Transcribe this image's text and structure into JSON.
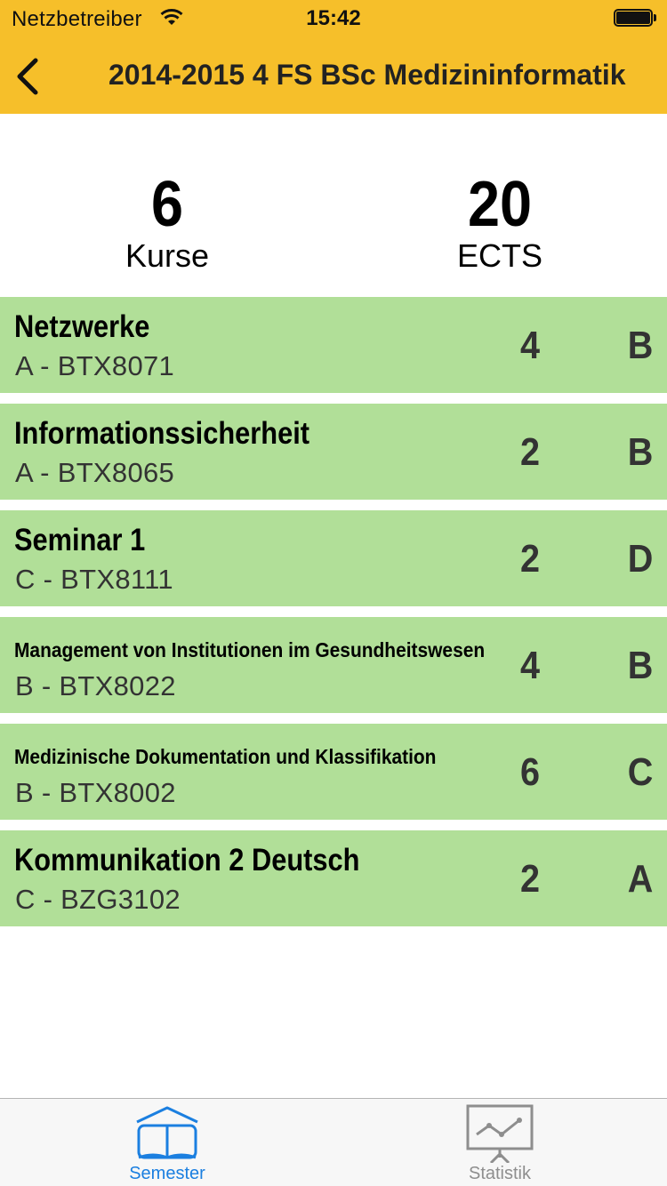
{
  "status_bar": {
    "carrier": "Netzbetreiber",
    "time": "15:42"
  },
  "nav": {
    "title": "2014-2015 4 FS BSc Medizininformatik",
    "back_icon": "chevron-left-icon"
  },
  "summary": {
    "courses_count": "6",
    "courses_label": "Kurse",
    "ects_total": "20",
    "ects_label": "ECTS"
  },
  "courses": [
    {
      "name": "Netzwerke",
      "code": "A - BTX8071",
      "ects": "4",
      "grade": "B"
    },
    {
      "name": "Informationssicherheit",
      "code": "A - BTX8065",
      "ects": "2",
      "grade": "B"
    },
    {
      "name": "Seminar 1",
      "code": "C - BTX8111",
      "ects": "2",
      "grade": "D"
    },
    {
      "name": "Management von Institutionen im Gesundheitswesen",
      "code": "B - BTX8022",
      "ects": "4",
      "grade": "B"
    },
    {
      "name": "Medizinische Dokumentation und Klassifikation",
      "code": "B - BTX8002",
      "ects": "6",
      "grade": "C"
    },
    {
      "name": "Kommunikation 2 Deutsch",
      "code": "C - BZG3102",
      "ects": "2",
      "grade": "A"
    }
  ],
  "tabbar": {
    "tabs": [
      {
        "label": "Semester",
        "icon": "book-icon",
        "selected": true
      },
      {
        "label": "Statistik",
        "icon": "chart-board-icon",
        "selected": false
      }
    ]
  },
  "colors": {
    "nav_background": "#f6bf2a",
    "course_background": "#b1df98",
    "tab_active": "#1b7fe0",
    "tab_inactive": "#8e8e8e"
  }
}
